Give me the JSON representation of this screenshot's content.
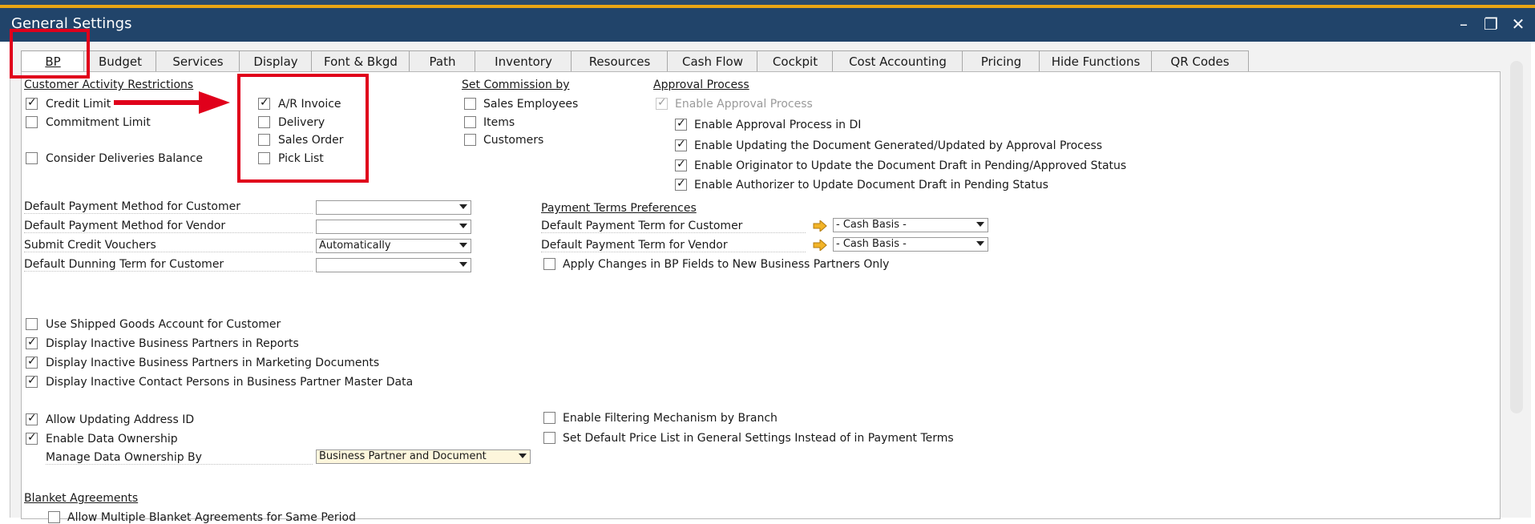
{
  "window": {
    "title": "General Settings",
    "controls": {
      "minimize": "–",
      "restore": "❐",
      "close": "✕"
    }
  },
  "tabs": [
    {
      "label": "BP",
      "active": true
    },
    {
      "label": "Budget"
    },
    {
      "label": "Services"
    },
    {
      "label": "Display"
    },
    {
      "label": "Font & Bkgd"
    },
    {
      "label": "Path"
    },
    {
      "label": "Inventory"
    },
    {
      "label": "Resources"
    },
    {
      "label": "Cash Flow"
    },
    {
      "label": "Cockpit"
    },
    {
      "label": "Cost Accounting"
    },
    {
      "label": "Pricing"
    },
    {
      "label": "Hide Functions"
    },
    {
      "label": "QR Codes"
    }
  ],
  "customer_activity": {
    "heading": "Customer Activity Restrictions",
    "credit_limit": {
      "label": "Credit Limit",
      "checked": true
    },
    "commitment_limit": {
      "label": "Commitment Limit",
      "checked": false
    },
    "consider_deliveries": {
      "label": "Consider Deliveries Balance",
      "checked": false
    }
  },
  "documents": {
    "ar_invoice": {
      "label": "A/R Invoice",
      "checked": true
    },
    "delivery": {
      "label": "Delivery",
      "checked": false
    },
    "sales_order": {
      "label": "Sales Order",
      "checked": false
    },
    "pick_list": {
      "label": "Pick List",
      "checked": false
    }
  },
  "commission": {
    "heading": "Set Commission by",
    "sales_employees": {
      "label": "Sales Employees",
      "checked": false
    },
    "items": {
      "label": "Items",
      "checked": false
    },
    "customers": {
      "label": "Customers",
      "checked": false
    }
  },
  "approval": {
    "heading": "Approval Process",
    "enable": {
      "label": "Enable Approval Process",
      "checked": true,
      "disabled": true
    },
    "in_di": {
      "label": "Enable Approval Process in DI",
      "checked": true
    },
    "updating_doc": {
      "label": "Enable Updating the Document Generated/Updated by Approval Process",
      "checked": true
    },
    "originator": {
      "label": "Enable Originator to Update the Document Draft in Pending/Approved Status",
      "checked": true
    },
    "authorizer": {
      "label": "Enable Authorizer to Update Document Draft in Pending Status",
      "checked": true
    }
  },
  "payment_fields": {
    "customer_method": {
      "label": "Default Payment Method for Customer",
      "value": ""
    },
    "vendor_method": {
      "label": "Default Payment Method for Vendor",
      "value": ""
    },
    "credit_vouchers": {
      "label": "Submit Credit Vouchers",
      "value": "Automatically"
    },
    "dunning_term": {
      "label": "Default Dunning Term for Customer",
      "value": ""
    }
  },
  "payment_terms": {
    "heading": "Payment Terms Preferences",
    "customer_term": {
      "label": "Default Payment Term for Customer",
      "value": "- Cash Basis -"
    },
    "vendor_term": {
      "label": "Default Payment Term for Vendor",
      "value": "- Cash Basis -"
    },
    "apply_changes": {
      "label": "Apply Changes in BP Fields to New Business Partners Only",
      "checked": false
    }
  },
  "misc": {
    "shipped_goods": {
      "label": "Use Shipped Goods Account for Customer",
      "checked": false
    },
    "inactive_reports": {
      "label": "Display Inactive Business Partners in Reports",
      "checked": true
    },
    "inactive_marketing": {
      "label": "Display Inactive Business Partners in Marketing Documents",
      "checked": true
    },
    "inactive_contacts": {
      "label": "Display Inactive Contact Persons in Business Partner Master Data",
      "checked": true
    },
    "address_id": {
      "label": "Allow Updating Address ID",
      "checked": true
    },
    "data_ownership": {
      "label": "Enable Data Ownership",
      "checked": true
    },
    "manage_ownership": {
      "label": "Manage Data Ownership By",
      "value": "Business Partner and Document"
    },
    "filtering_branch": {
      "label": "Enable Filtering Mechanism by Branch",
      "checked": false
    },
    "default_price_list": {
      "label": "Set Default Price List in General Settings Instead of in Payment Terms",
      "checked": false
    }
  },
  "blanket": {
    "heading": "Blanket Agreements",
    "multiple": {
      "label": "Allow Multiple Blanket Agreements for Same Period",
      "checked": false
    }
  },
  "colors": {
    "titlebar": "#21446a",
    "accent_stripe": "#e8a514",
    "highlight": "#e0001b"
  }
}
